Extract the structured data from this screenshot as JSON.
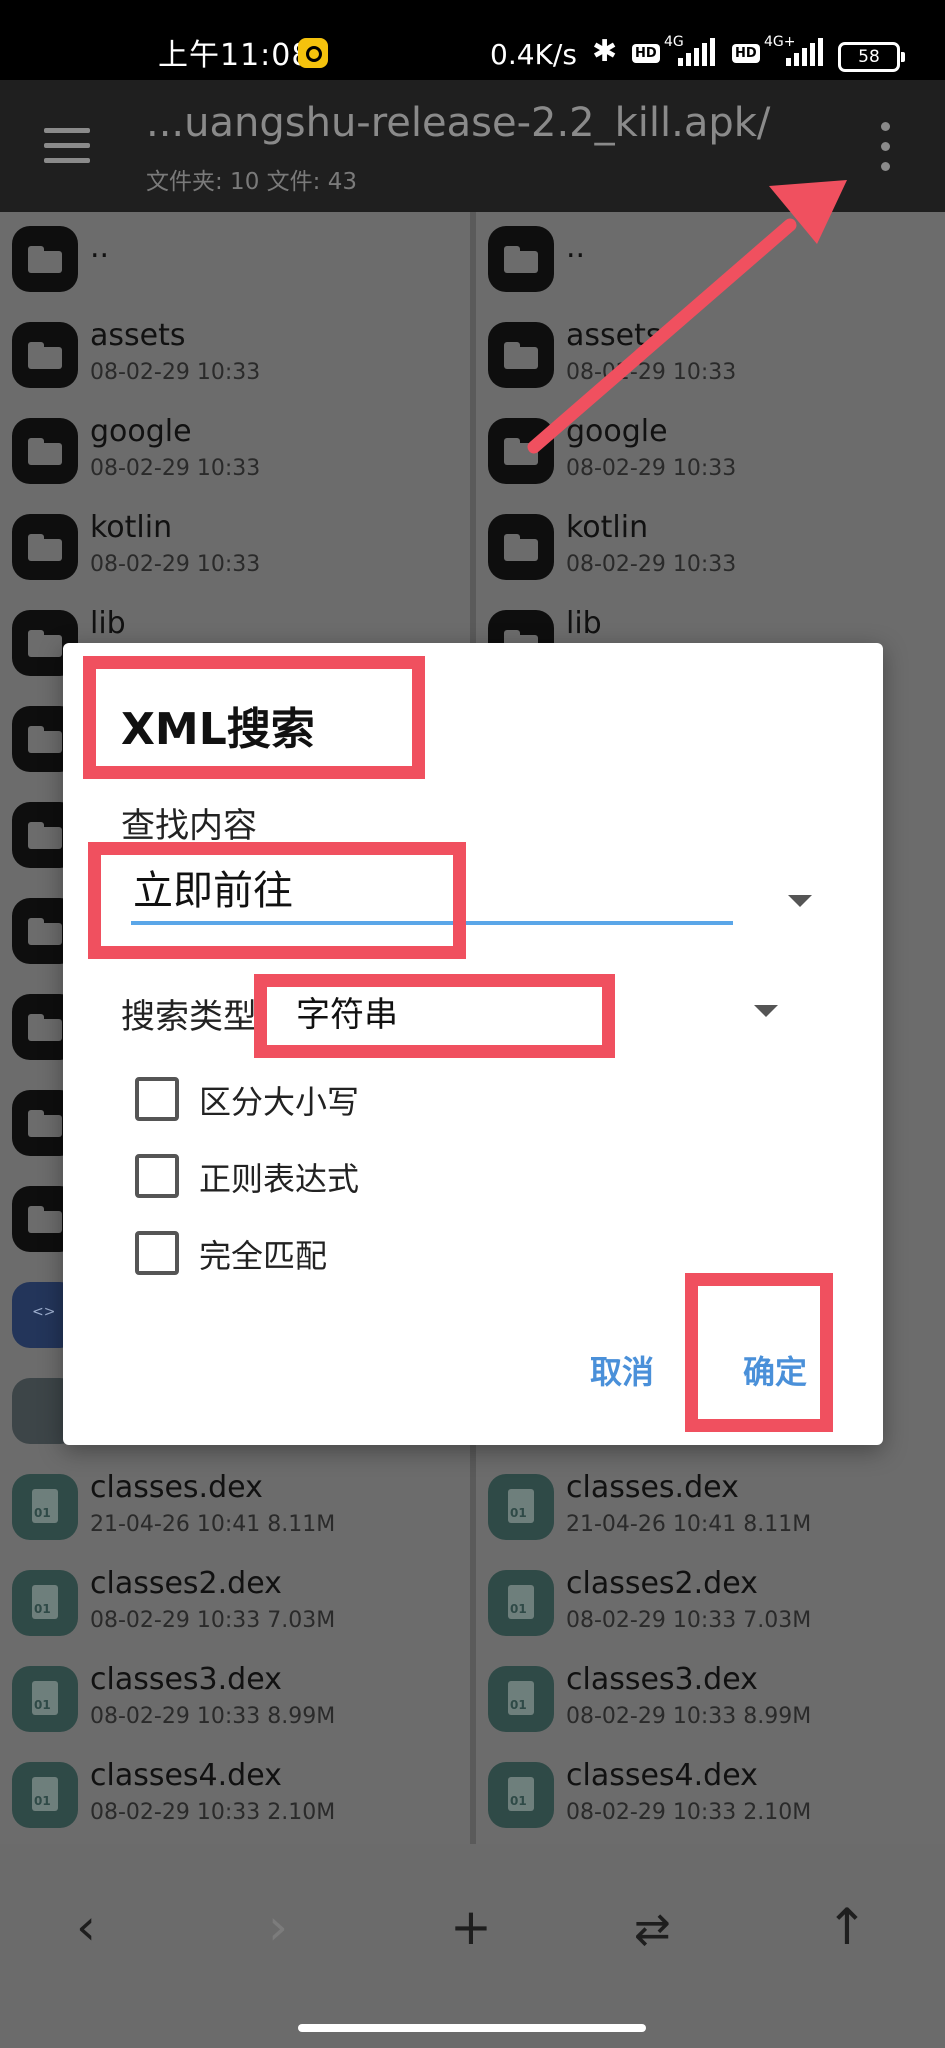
{
  "status_bar": {
    "time": "上午11:08",
    "net_speed": "0.4K/s",
    "hd1": "HD",
    "net1": "4G",
    "hd2": "HD",
    "net2": "4G+",
    "battery": "58"
  },
  "app_bar": {
    "path": "...uangshu-release-2.2_kill.apk/",
    "counts": "文件夹: 10  文件: 43"
  },
  "left_pane": {
    "items": [
      {
        "name": "..",
        "meta": ""
      },
      {
        "name": "assets",
        "meta": "08-02-29 10:33"
      },
      {
        "name": "google",
        "meta": "08-02-29 10:33"
      },
      {
        "name": "kotlin",
        "meta": "08-02-29 10:33"
      },
      {
        "name": "lib",
        "meta": ""
      },
      {
        "name": "classes.dex",
        "meta": "21-04-26 10:41  8.11M"
      },
      {
        "name": "classes2.dex",
        "meta": "08-02-29 10:33  7.03M"
      },
      {
        "name": "classes3.dex",
        "meta": "08-02-29 10:33  8.99M"
      },
      {
        "name": "classes4.dex",
        "meta": "08-02-29 10:33  2.10M"
      }
    ]
  },
  "right_pane": {
    "items": [
      {
        "name": "..",
        "meta": ""
      },
      {
        "name": "assets",
        "meta": "08-02-29 10:33"
      },
      {
        "name": "google",
        "meta": "08-02-29 10:33"
      },
      {
        "name": "kotlin",
        "meta": "08-02-29 10:33"
      },
      {
        "name": "lib",
        "meta": ""
      },
      {
        "name": "classes.dex",
        "meta": "21-04-26 10:41  8.11M"
      },
      {
        "name": "classes2.dex",
        "meta": "08-02-29 10:33  7.03M"
      },
      {
        "name": "classes3.dex",
        "meta": "08-02-29 10:33  8.99M"
      },
      {
        "name": "classes4.dex",
        "meta": "08-02-29 10:33  2.10M"
      }
    ]
  },
  "dialog": {
    "title": "XML搜索",
    "find_label": "查找内容",
    "find_value": "立即前往",
    "type_label": "搜索类型",
    "type_value": "字符串",
    "options": [
      {
        "label": "区分大小写",
        "checked": false
      },
      {
        "label": "正则表达式",
        "checked": false
      },
      {
        "label": "完全匹配",
        "checked": false
      }
    ],
    "cancel_label": "取消",
    "ok_label": "确定",
    "accent_color": "#4a90d9"
  },
  "bottom_bar": {
    "back_icon": "chevron-left-icon",
    "forward_icon": "chevron-right-icon",
    "add_icon": "plus-icon",
    "swap_icon": "swap-icon",
    "up_icon": "arrow-up-icon"
  },
  "annotation_color": "#f0505f"
}
